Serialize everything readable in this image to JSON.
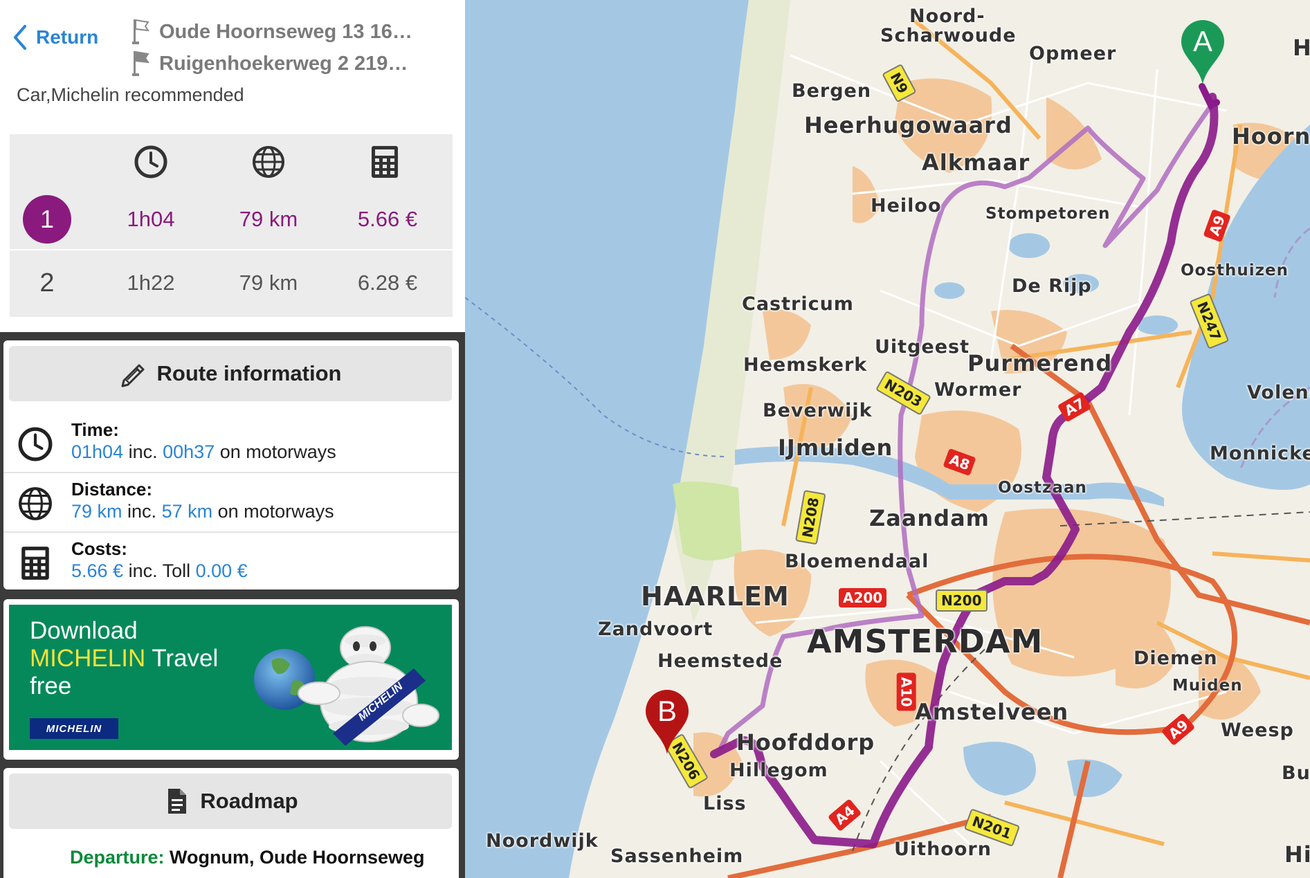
{
  "header": {
    "return_label": "Return",
    "from_address": "Oude Hoornseweg 13 16…",
    "to_address": "Ruigenhoekerweg 2 219…",
    "mode": "Car,Michelin recommended"
  },
  "route_options": {
    "columns": [
      "clock-icon",
      "globe-icon",
      "calculator-icon"
    ],
    "rows": [
      {
        "index": "1",
        "time": "1h04",
        "distance": "79 km",
        "cost": "5.66  €",
        "selected": true
      },
      {
        "index": "2",
        "time": "1h22",
        "distance": "79 km",
        "cost": "6.28  €",
        "selected": false
      }
    ]
  },
  "route_info": {
    "header": "Route information",
    "time": {
      "title": "Time:",
      "total": "01h04",
      "inc": " inc. ",
      "motorway": "00h37",
      "suffix": " on motorways"
    },
    "distance": {
      "title": "Distance:",
      "total": "79 km",
      "inc": " inc. ",
      "motorway": "57 km",
      "suffix": " on motorways"
    },
    "costs": {
      "title": "Costs:",
      "total": "5.66 €",
      "inc": " inc. Toll ",
      "toll": "0.00 €"
    }
  },
  "promo": {
    "line1": "Download",
    "line2_brand": "MICHELIN",
    "line2_rest": " Travel",
    "line3": "free",
    "logo_text": "MICHELIN",
    "sash_text": "MICHELIN"
  },
  "roadmap": {
    "header": "Roadmap",
    "departure_label": "Departure:",
    "departure_value": " Wognum, Oude Hoornseweg"
  },
  "map": {
    "route_color": "#8b1a8a",
    "start_marker": "A",
    "end_marker": "B",
    "places": [
      "Noord-",
      "Scharwoude",
      "Opmeer",
      "Bergen",
      "Heerhugowaard",
      "Alkmaar",
      "Heiloo",
      "Stompetoren",
      "Hoorn",
      "De Rijp",
      "Oosthuizen",
      "Castricum",
      "Uitgeest",
      "Heemskerk",
      "Purmerend",
      "Wormer",
      "Volend",
      "Beverwijk",
      "IJmuiden",
      "Monnicke",
      "Oostzaan",
      "Zaandam",
      "Bloemendaal",
      "HAARLEM",
      "Zandvoort",
      "AMSTERDAM",
      "Heemstede",
      "Diemen",
      "Muiden",
      "Amstelveen",
      "Weesp",
      "Hoofddorp",
      "Hillegom",
      "Buss",
      "Liss",
      "Noordwijk",
      "Sassenheim",
      "Uithoorn",
      "H",
      "Hi"
    ],
    "roads": [
      "N9",
      "A9",
      "N203",
      "A8",
      "N208",
      "A200",
      "N200",
      "A10",
      "A9",
      "N201",
      "N247",
      "A7",
      "A4",
      "N206"
    ]
  }
}
